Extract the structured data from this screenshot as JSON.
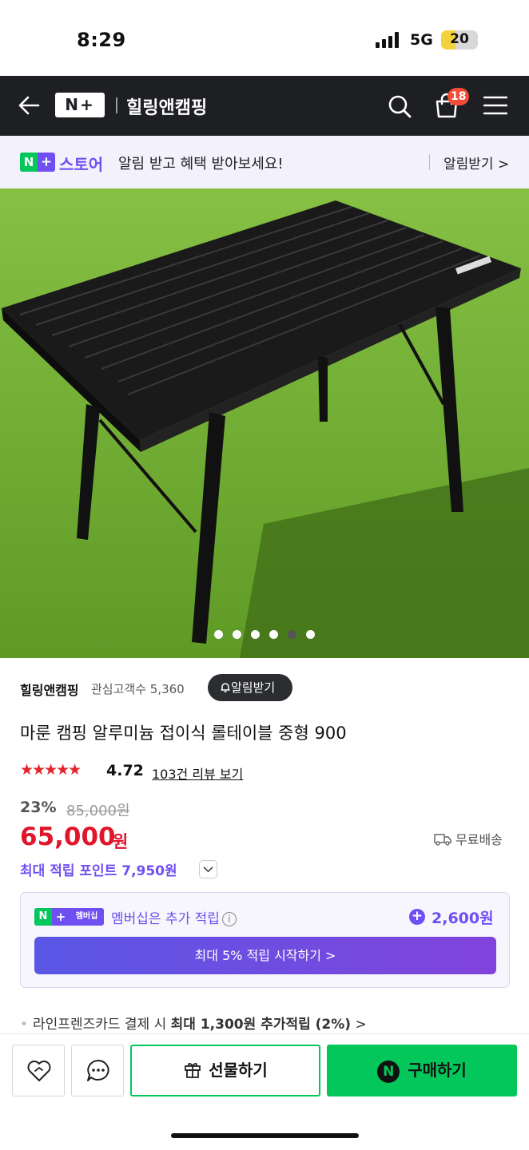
{
  "status_bar": {
    "time": "8:29",
    "network": "5G",
    "battery": "20"
  },
  "header": {
    "logo": "N+",
    "shop_name": "힐링앤캠핑",
    "cart_count": "18"
  },
  "promo": {
    "brand": "N+",
    "store": "스토어",
    "message": "알림 받고 혜택 받아보세요!",
    "action": "알림받기 >"
  },
  "gallery": {
    "total": 6,
    "active_index": 4
  },
  "product": {
    "store_name": "힐링앤캠핑",
    "interest": "관심고객수 5,360",
    "alarm_button": "알림받기",
    "title": "마룬 캠핑 알루미늄 접이식 롤테이블 중형 900",
    "stars": "★★★★★",
    "rating": "4.72",
    "reviews": "103건 리뷰 보기",
    "discount": "23%",
    "original_price": "85,000원",
    "price": "65,000",
    "price_unit": "원",
    "shipping": "무료배송",
    "points": "최대 적립 포인트 7,950원"
  },
  "membership": {
    "tag_label": "멤버십",
    "description": "멤버십은 추가 적립",
    "info": "i",
    "amount": "2,600원",
    "cta": "최대 5% 적립 시작하기 >"
  },
  "card_note": {
    "prefix": "라인프렌즈카드 결제 시",
    "highlight": "최대 1,300원 추가적립 (2%)",
    "suffix": ">"
  },
  "bottom_bar": {
    "gift_label": "선물하기",
    "buy_label": "구매하기",
    "buy_badge": "N"
  },
  "colors": {
    "naver_green": "#03c75a",
    "purple": "#6f4ff2",
    "price_red": "#e0162b",
    "header_bg": "#1d1f23"
  }
}
